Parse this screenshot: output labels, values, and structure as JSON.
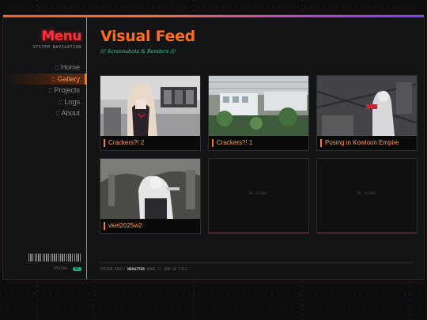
{
  "sidebar": {
    "title": "Menu",
    "subtitle": "SYSTEM NAVIGATION",
    "items": [
      {
        "label": ":: Home"
      },
      {
        "label": ":: Gallery"
      },
      {
        "label": ":: Projects"
      },
      {
        "label": ":: Logs"
      },
      {
        "label": ":: About"
      }
    ],
    "active_index": 1,
    "status_label": "STATUS:",
    "status_value": "OK"
  },
  "main": {
    "title": "Visual Feed",
    "subtitle": "/// Screenshots & Renders ///",
    "cards": [
      {
        "label": "Crackers?! 2"
      },
      {
        "label": "Crackers?! 1"
      },
      {
        "label": "Posing in Kowloon Empire"
      },
      {
        "label": "vket2025w2"
      }
    ],
    "empty_cards": [
      {
        "text": "NO_SIGNAL"
      },
      {
        "text": "NO_SIGNAL"
      }
    ],
    "footer": {
      "prefix": "SYSTEM_ROOT:",
      "user": "NEOGITER",
      "middle": "NODE // END OF FILE"
    }
  },
  "colors": {
    "accent": "#ff6b1f",
    "menu_title": "#ff2e3a",
    "subtitle": "#3fd0a8",
    "status_ok": "#2fa07a"
  }
}
